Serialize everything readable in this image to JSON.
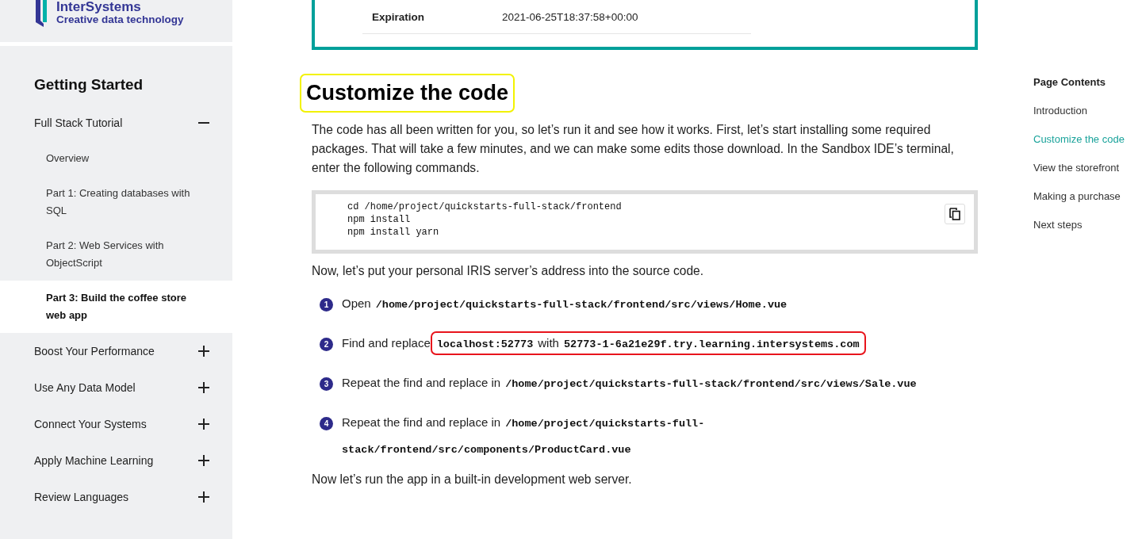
{
  "sidebar": {
    "logo": {
      "wordmark": "InterSystems",
      "tagline": "Creative data technology"
    },
    "title": "Getting Started",
    "sections": [
      {
        "label": "Full Stack Tutorial",
        "expanded": true,
        "children": [
          {
            "label": "Overview",
            "selected": false
          },
          {
            "label": "Part 1: Creating databases with SQL",
            "selected": false
          },
          {
            "label": "Part 2: Web Services with ObjectScript",
            "selected": false
          },
          {
            "label": "Part 3: Build the coffee store web app",
            "selected": true
          }
        ]
      },
      {
        "label": "Boost Your Performance",
        "expanded": false
      },
      {
        "label": "Use Any Data Model",
        "expanded": false
      },
      {
        "label": "Connect Your Systems",
        "expanded": false
      },
      {
        "label": "Apply Machine Learning",
        "expanded": false
      },
      {
        "label": "Review Languages",
        "expanded": false
      }
    ]
  },
  "info_card": {
    "rows": [
      {
        "label": "Expiration",
        "value": "2021-06-25T18:37:58+00:00"
      }
    ]
  },
  "heading": {
    "text": "Customize the code",
    "highlighted": true
  },
  "intro": "The code has all been written for you, so let’s run it and see how it works. First, let’s start installing some required packages. That will take a few minutes, and we can make some edits those download. In the Sandbox IDE’s terminal, enter the following commands.",
  "code_block": {
    "lines": [
      "cd /home/project/quickstarts-full-stack/frontend",
      "npm install",
      "npm install yarn"
    ]
  },
  "address_note": "Now, let’s put your personal IRIS server’s address into the source code.",
  "steps": [
    {
      "number": "1",
      "parts": [
        {
          "kind": "text",
          "text": "Open"
        },
        {
          "kind": "code",
          "text": "/home/project/quickstarts-full-stack/frontend/src/views/Home.vue"
        }
      ]
    },
    {
      "number": "2",
      "parts": [
        {
          "kind": "text",
          "text": "Find and replace"
        }
      ],
      "boxed_parts": [
        {
          "kind": "code",
          "text": "localhost:52773"
        },
        {
          "kind": "text",
          "text": "with"
        },
        {
          "kind": "code",
          "text": "52773-1-6a21e29f.try.learning.intersystems.com"
        }
      ]
    },
    {
      "number": "3",
      "parts": [
        {
          "kind": "text",
          "text": "Repeat the find and replace in"
        },
        {
          "kind": "code",
          "text": "/home/project/quickstarts-full-stack/frontend/src/views/Sale.vue"
        }
      ]
    },
    {
      "number": "4",
      "parts": [
        {
          "kind": "text",
          "text": "Repeat the find and replace in"
        },
        {
          "kind": "code",
          "text": "/home/project/quickstarts-full-stack/frontend/src/components/ProductCard.vue"
        }
      ]
    }
  ],
  "outro": "Now let’s run the app in a built-in development web server.",
  "page_contents": {
    "title": "Page Contents",
    "items": [
      {
        "label": "Introduction",
        "selected": false
      },
      {
        "label": "Customize the code",
        "selected": true
      },
      {
        "label": "View the storefront",
        "selected": false
      },
      {
        "label": "Making a purchase",
        "selected": false
      },
      {
        "label": "Next steps",
        "selected": false
      }
    ]
  }
}
